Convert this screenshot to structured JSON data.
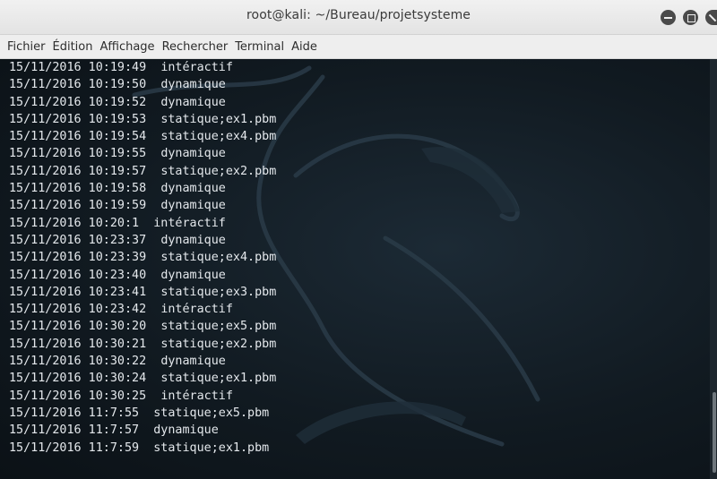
{
  "window": {
    "title": "root@kali: ~/Bureau/projetsysteme"
  },
  "menubar": {
    "items": [
      "Fichier",
      "Édition",
      "Affichage",
      "Rechercher",
      "Terminal",
      "Aide"
    ]
  },
  "terminal": {
    "lines": [
      {
        "ts": "15/11/2016 10:19:49  ",
        "msg": "intéractif"
      },
      {
        "ts": "15/11/2016 10:19:50  ",
        "msg": "dynamique"
      },
      {
        "ts": "15/11/2016 10:19:52  ",
        "msg": "dynamique"
      },
      {
        "ts": "15/11/2016 10:19:53  ",
        "msg": "statique;ex1.pbm"
      },
      {
        "ts": "15/11/2016 10:19:54  ",
        "msg": "statique;ex4.pbm"
      },
      {
        "ts": "15/11/2016 10:19:55  ",
        "msg": "dynamique"
      },
      {
        "ts": "15/11/2016 10:19:57  ",
        "msg": "statique;ex2.pbm"
      },
      {
        "ts": "15/11/2016 10:19:58  ",
        "msg": "dynamique"
      },
      {
        "ts": "15/11/2016 10:19:59  ",
        "msg": "dynamique"
      },
      {
        "ts": "15/11/2016 10:20:1  ",
        "msg": "intéractif"
      },
      {
        "ts": "15/11/2016 10:23:37  ",
        "msg": "dynamique"
      },
      {
        "ts": "15/11/2016 10:23:39  ",
        "msg": "statique;ex4.pbm"
      },
      {
        "ts": "15/11/2016 10:23:40  ",
        "msg": "dynamique"
      },
      {
        "ts": "15/11/2016 10:23:41  ",
        "msg": "statique;ex3.pbm"
      },
      {
        "ts": "15/11/2016 10:23:42  ",
        "msg": "intéractif"
      },
      {
        "ts": "15/11/2016 10:30:20  ",
        "msg": "statique;ex5.pbm"
      },
      {
        "ts": "15/11/2016 10:30:21  ",
        "msg": "statique;ex2.pbm"
      },
      {
        "ts": "15/11/2016 10:30:22  ",
        "msg": "dynamique"
      },
      {
        "ts": "15/11/2016 10:30:24  ",
        "msg": "statique;ex1.pbm"
      },
      {
        "ts": "15/11/2016 10:30:25  ",
        "msg": "intéractif"
      },
      {
        "ts": "15/11/2016 11:7:55  ",
        "msg": "statique;ex5.pbm"
      },
      {
        "ts": "15/11/2016 11:7:57  ",
        "msg": "dynamique"
      },
      {
        "ts": "15/11/2016 11:7:59  ",
        "msg": "statique;ex1.pbm"
      }
    ]
  },
  "colors": {
    "terminal_bg": "#111a21",
    "terminal_fg": "#e4e8ec",
    "titlebar_bg": "#ececec",
    "menubar_bg": "#eeeeee"
  },
  "icons": [
    "minimize-icon",
    "maximize-icon",
    "close-icon",
    "kali-dragon-wallpaper"
  ]
}
